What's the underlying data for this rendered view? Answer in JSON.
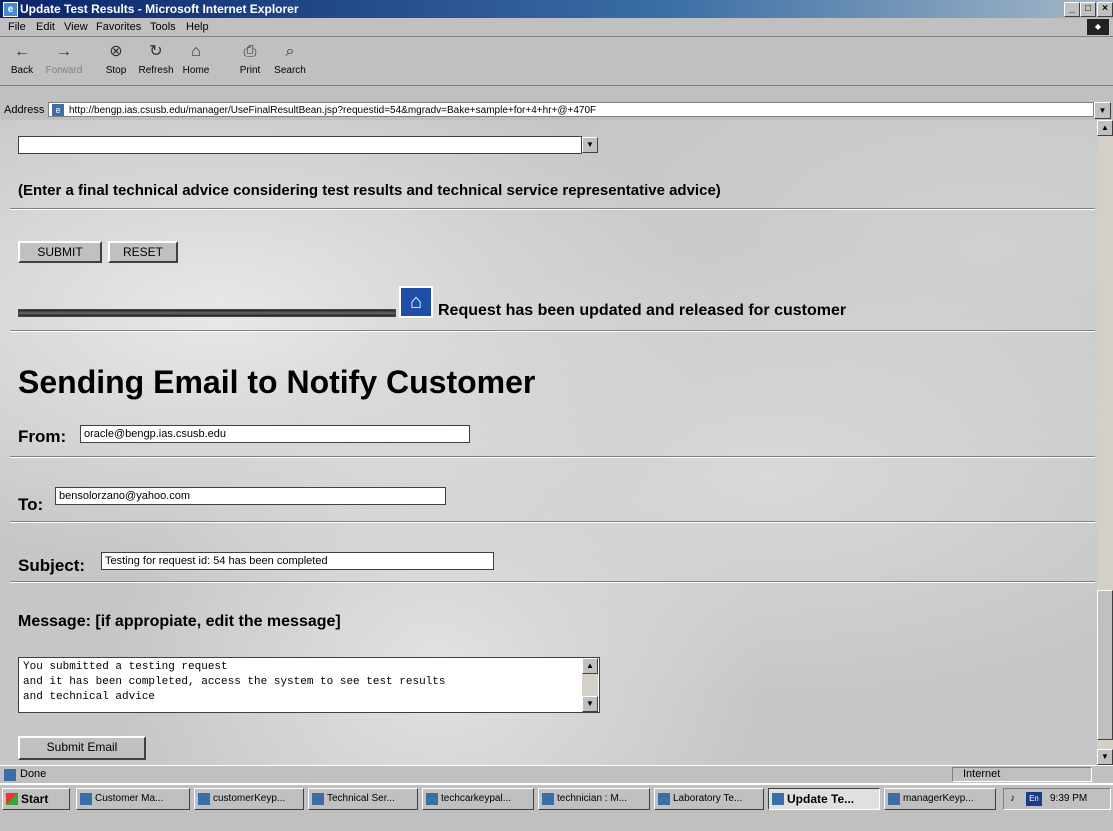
{
  "window": {
    "title": "Update Test Results - Microsoft Internet Explorer",
    "min": "_",
    "max": "□",
    "close": "×"
  },
  "menu": [
    "File",
    "Edit",
    "View",
    "Favorites",
    "Tools",
    "Help"
  ],
  "toolbar": [
    {
      "label": "Back",
      "icon": "←",
      "disabled": false
    },
    {
      "label": "Forward",
      "icon": "→",
      "disabled": true
    },
    {
      "label": "Stop",
      "icon": "⊗",
      "disabled": false
    },
    {
      "label": "Refresh",
      "icon": "↻",
      "disabled": false
    },
    {
      "label": "Home",
      "icon": "⌂",
      "disabled": false
    },
    {
      "label": "Print",
      "icon": "⎙",
      "disabled": false
    },
    {
      "label": "Search",
      "icon": "⌕",
      "disabled": false
    }
  ],
  "address": {
    "label": "Address",
    "url": "http://bengp.ias.csusb.edu/manager/UseFinalResultBean.jsp?requestid=54&mgradv=Bake+sample+for+4+hr+@+470F"
  },
  "form": {
    "advice_note": "(Enter a final technical advice considering test results and technical service representative advice)",
    "submit_label": "SUBMIT",
    "reset_label": "RESET",
    "update_message": "Request has been updated and released for customer"
  },
  "email": {
    "heading": "Sending Email to Notify Customer",
    "from_label": "From:",
    "from_value": "oracle@bengp.ias.csusb.edu",
    "to_label": "To:",
    "to_value": "bensolorzano@yahoo.com",
    "subject_label": "Subject:",
    "subject_value": "Testing for request id: 54 has been completed",
    "message_label": "Message: [if appropiate, edit the message]",
    "message_body": "You submitted a testing request\nand it has been completed, access the system to see test results\nand technical advice",
    "submit_email_label": "Submit Email"
  },
  "status": {
    "left": "Done",
    "zone": "Internet"
  },
  "taskbar": {
    "start": "Start",
    "tasks": [
      "Customer Ma...",
      "customerKeyp...",
      "Technical Ser...",
      "techcarkeypal...",
      "technician : M...",
      "Laboratory Te...",
      "Update Te...",
      "managerKeyp..."
    ],
    "active_index": 6,
    "clock": "9:39 PM"
  }
}
